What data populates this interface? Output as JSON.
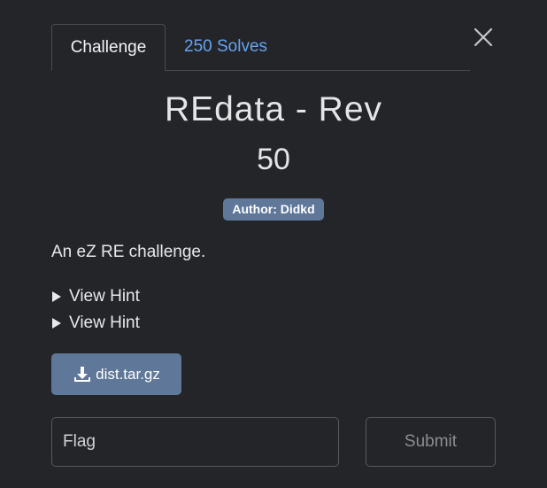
{
  "tabs": {
    "challenge_label": "Challenge",
    "solves_label": "250 Solves"
  },
  "challenge": {
    "title": "REdata - Rev",
    "points": "50",
    "author_badge": "Author: Didkd",
    "description": "An eZ RE challenge."
  },
  "hints": [
    {
      "label": "View Hint"
    },
    {
      "label": "View Hint"
    }
  ],
  "file": {
    "name": "dist.tar.gz",
    "icon": "download-icon"
  },
  "submission": {
    "flag_placeholder": "Flag",
    "flag_value": "",
    "submit_label": "Submit"
  },
  "colors": {
    "background": "#232529",
    "accent": "#5f7799",
    "link": "#66a3ef"
  }
}
